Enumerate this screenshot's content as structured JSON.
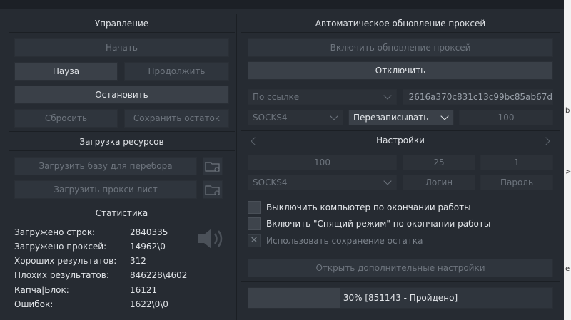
{
  "control": {
    "title": "Управление",
    "start": "Начать",
    "pause": "Пауза",
    "resume": "Продолжить",
    "stop": "Остановить",
    "reset": "Сбросить",
    "save_rest": "Сохранить остаток"
  },
  "resources": {
    "title": "Загрузка ресурсов",
    "load_base": "Загрузить базу для перебора",
    "load_proxy": "Загрузить прокси лист"
  },
  "stats": {
    "title": "Статистика",
    "rows": [
      {
        "label": "Загружено строк:",
        "value": "2840335"
      },
      {
        "label": "Загружено проксей:",
        "value": "14962\\0"
      },
      {
        "label": "Хороших результатов:",
        "value": "312"
      },
      {
        "label": "Плохих результатов:",
        "value": "846228\\4602"
      },
      {
        "label": "Капча|Блок:",
        "value": "16121"
      },
      {
        "label": "Ошибок:",
        "value": "1622\\0\\0"
      }
    ]
  },
  "autoupdate": {
    "title": "Автоматическое обновление проксей",
    "enable": "Включить обновление проксей",
    "disable": "Отключить",
    "source_select": "По ссылке",
    "url_value": "2616a370c831c13c99bc85ab67d",
    "proxy_type": "SOCKS4",
    "mode_select": "Перезаписывать",
    "interval": "100"
  },
  "settings": {
    "title": "Настройки",
    "threads": "100",
    "timeout": "25",
    "retries": "1",
    "proxy_type": "SOCKS4",
    "login_placeholder": "Логин",
    "password_placeholder": "Пароль",
    "options": [
      {
        "label": "Выключить компьютер по окончании работы",
        "checked": false,
        "enabled": true
      },
      {
        "label": "Включить \"Спящий режим\" по окончании работы",
        "checked": false,
        "enabled": true
      },
      {
        "label": "Использовать сохранение остатка",
        "checked": true,
        "enabled": false
      }
    ],
    "extra": "Открыть дополнительные настройки"
  },
  "progress": {
    "percent": 30,
    "text": "30% [851143 - Пройдено]"
  }
}
